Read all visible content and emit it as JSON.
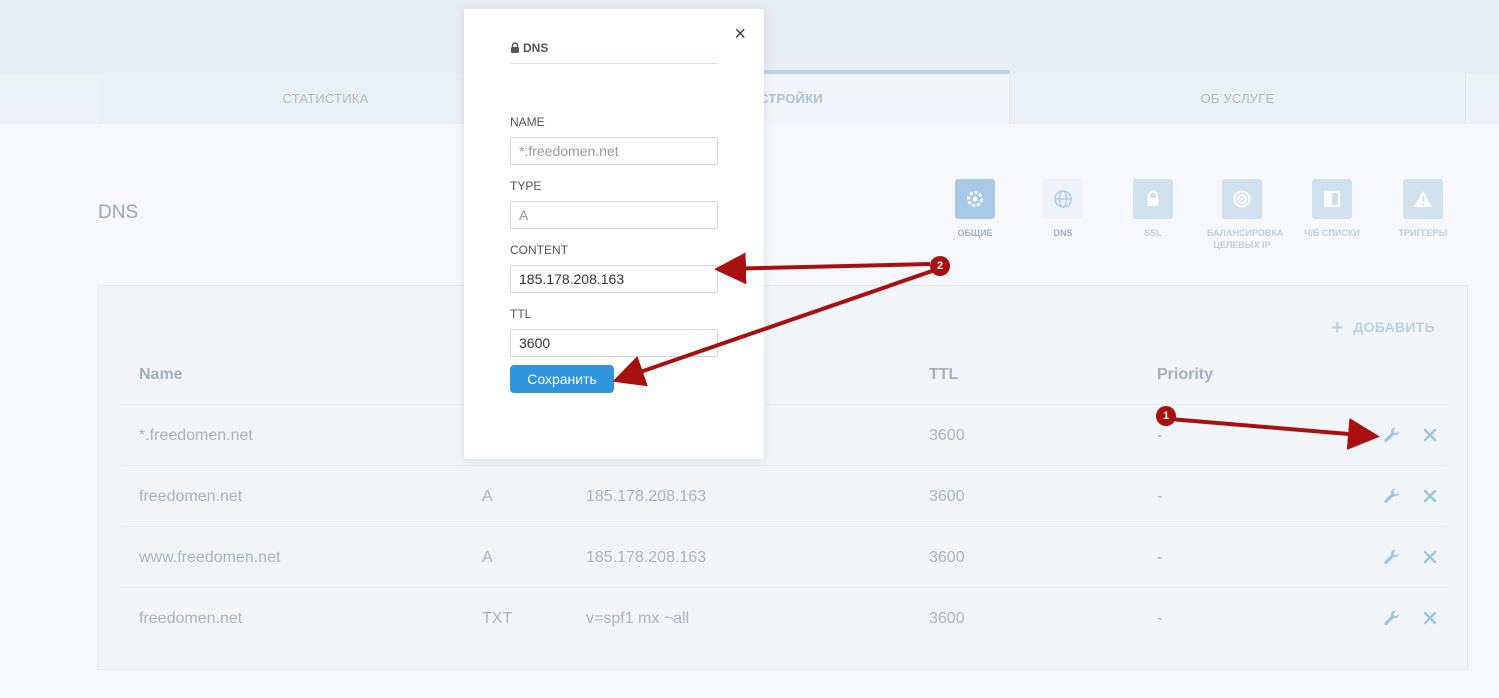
{
  "tabs": [
    {
      "label": "Статистика"
    },
    {
      "label": "Настройки"
    },
    {
      "label": "Об услуге"
    }
  ],
  "section": {
    "title": "DNS"
  },
  "icon_bar": [
    {
      "label": "Общие",
      "icon": "gear-icon"
    },
    {
      "label": "DNS",
      "icon": "globe-icon"
    },
    {
      "label": "SSL",
      "icon": "lock-icon"
    },
    {
      "label": "Балансировка целевых IP",
      "icon": "target-icon"
    },
    {
      "label": "Ч/Б списки",
      "icon": "panel-icon"
    },
    {
      "label": "Триггеры",
      "icon": "warning-icon"
    }
  ],
  "table": {
    "add_label": "Добавить",
    "headers": {
      "name": "Name",
      "ttl": "TTL",
      "priority": "Priority"
    },
    "rows": [
      {
        "name": "*.freedomen.net",
        "type": "",
        "content": "",
        "ttl": "3600",
        "priority": "-"
      },
      {
        "name": "freedomen.net",
        "type": "A",
        "content": "185.178.208.163",
        "ttl": "3600",
        "priority": "-"
      },
      {
        "name": "www.freedomen.net",
        "type": "A",
        "content": "185.178.208.163",
        "ttl": "3600",
        "priority": "-"
      },
      {
        "name": "freedomen.net",
        "type": "TXT",
        "content": "v=spf1 mx ~all",
        "ttl": "3600",
        "priority": "-"
      }
    ]
  },
  "modal": {
    "title": "DNS",
    "close": "×",
    "fields": {
      "name": {
        "label": "NAME",
        "value": "",
        "placeholder": "*.freedomen.net"
      },
      "type": {
        "label": "TYPE",
        "value": "",
        "placeholder": "A"
      },
      "content": {
        "label": "CONTENT",
        "value": "185.178.208.163"
      },
      "ttl": {
        "label": "TTL",
        "value": "3600"
      }
    },
    "save_label": "Сохранить"
  },
  "annotations": {
    "badge1": "1",
    "badge2": "2",
    "color": "#a80f0f"
  },
  "colors": {
    "accent": "#2f95dc",
    "annotation": "#a80f0f"
  }
}
